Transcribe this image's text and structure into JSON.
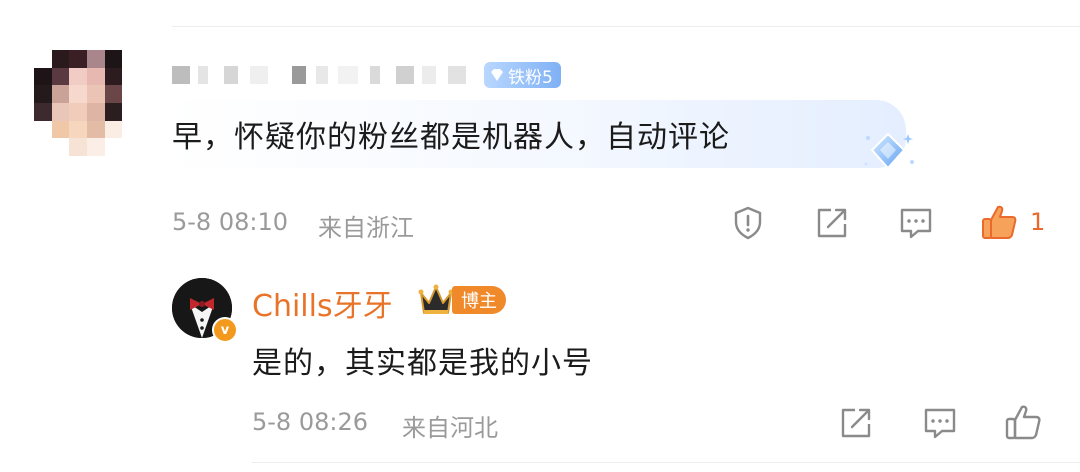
{
  "comment": {
    "level_badge": "铁粉5",
    "text": "早，怀疑你的粉丝都是机器人，自动评论",
    "time": "5-8 08:10",
    "location": "来自浙江",
    "like_count": "1",
    "colors": {
      "like_active": "#f07a2a",
      "meta": "#9a9a9a",
      "badge": "#8fbcf7"
    },
    "icons": [
      "report-icon",
      "share-icon",
      "reply-icon",
      "thumbs-up-icon"
    ]
  },
  "reply": {
    "author": "Chills牙牙",
    "author_badge": "博主",
    "verified_mark": "v",
    "text": "是的，其实都是我的小号",
    "time": "5-8 08:26",
    "location": "来自河北",
    "colors": {
      "author": "#e8742a",
      "badge": "#f0892a"
    },
    "icons": [
      "share-icon",
      "reply-icon",
      "thumbs-up-icon"
    ]
  }
}
